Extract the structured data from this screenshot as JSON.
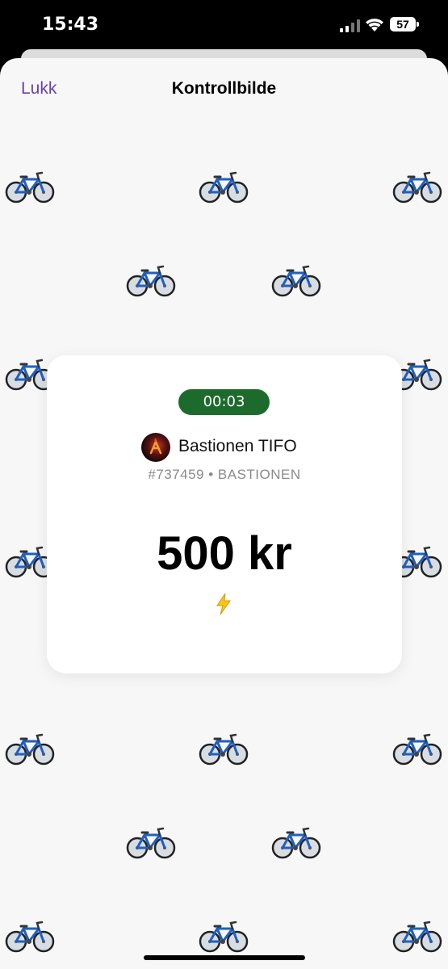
{
  "status_bar": {
    "time": "15:43",
    "battery": "57"
  },
  "nav": {
    "close_label": "Lukk",
    "title": "Kontrollbilde"
  },
  "background_icon": "bicycle-icon",
  "ticket": {
    "timer": "00:03",
    "event_name": "Bastionen TIFO",
    "meta": "#737459 • BASTIONEN",
    "amount": "500 kr",
    "status_icon": "lightning-bolt-icon"
  },
  "colors": {
    "accent": "#6a3fb0",
    "timer_badge": "#1d6b2c",
    "sheet_background": "#f7f7f7",
    "meta_text": "#8a8a8a"
  }
}
